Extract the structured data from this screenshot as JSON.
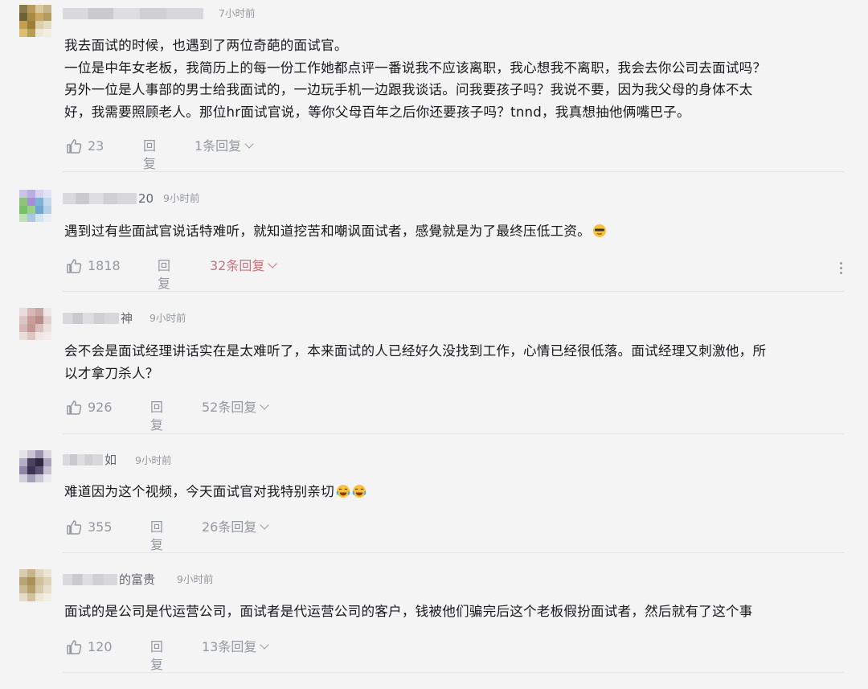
{
  "comments": [
    {
      "name_suffix": "",
      "time": "7小时前",
      "text": "我去面试的时候，也遇到了两位奇葩的面试官。\n一位是中年女老板，我简历上的每一份工作她都点评一番说我不应该离职，我心想我不离职，我会去你公司去面试吗？\n另外一位是人事部的男士给我面试的，一边玩手机一边跟我谈话。问我要孩子吗？我说不要，因为我父母的身体不太\n好，我需要照顾老人。那位hr面试官说，等你父母百年之后你还要孩子吗？tnnd，我真想抽他俩嘴巴子。",
      "likes": "23",
      "reply_label": "回复",
      "replies": "1条回复"
    },
    {
      "name_suffix": "20",
      "time": "9小时前",
      "text": "遇到过有些面試官说话特难听，就知道挖苦和嘲讽面试者，感覺就是为了最终压低工资。",
      "emoji": "cool-face-emoji",
      "likes": "1818",
      "reply_label": "回复",
      "replies": "32条回复"
    },
    {
      "name_suffix": "神",
      "time": "9小时前",
      "text": "会不会是面试经理讲话实在是太难听了，本来面试的人已经好久没找到工作，心情已经很低落。面试经理又刺激他，所\n以才拿刀杀人？",
      "likes": "926",
      "reply_label": "回复",
      "replies": "52条回复"
    },
    {
      "name_suffix": "如",
      "time": "9小时前",
      "text": "难道因为这个视频，今天面试官对我特别亲切",
      "emoji": "laugh-cry-emoji",
      "likes": "355",
      "reply_label": "回复",
      "replies": "26条回复"
    },
    {
      "name_suffix": "的富贵",
      "time": "9小时前",
      "text": "面试的是公司是代运营公司，面试者是代运营公司的客户，钱被他们骗完后这个老板假扮面试者，然后就有了这个事",
      "likes": "120",
      "reply_label": "回复",
      "replies": "13条回复"
    }
  ],
  "colors": {
    "background": "#f4f4f4",
    "text": "#18191c",
    "meta": "#9499a0",
    "hot_replies": "#c0757d"
  }
}
